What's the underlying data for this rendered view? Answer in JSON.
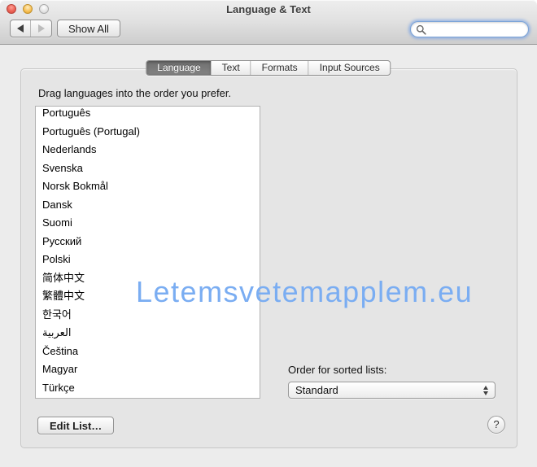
{
  "window": {
    "title": "Language & Text"
  },
  "toolbar": {
    "back_icon": "left-triangle",
    "forward_icon": "right-triangle",
    "show_all_label": "Show All",
    "search": {
      "value": "",
      "placeholder": "",
      "icon": "magnifier"
    }
  },
  "tabs": [
    {
      "label": "Language",
      "selected": true
    },
    {
      "label": "Text",
      "selected": false
    },
    {
      "label": "Formats",
      "selected": false
    },
    {
      "label": "Input Sources",
      "selected": false
    }
  ],
  "content": {
    "instruction": "Drag languages into the order you prefer.",
    "languages": [
      "Português",
      "Português (Portugal)",
      "Nederlands",
      "Svenska",
      "Norsk Bokmål",
      "Dansk",
      "Suomi",
      "Русский",
      "Polski",
      "简体中文",
      "繁體中文",
      "한국어",
      "العربية",
      "Čeština",
      "Magyar",
      "Türkçe"
    ],
    "sorted_lists_label": "Order for sorted lists:",
    "sorted_lists_value": "Standard",
    "edit_list_label": "Edit List…",
    "help_label": "?"
  },
  "watermark": {
    "text": "Letemsvetemapplem.eu",
    "color": "#7aadf2"
  },
  "colors": {
    "selected_tab": "#7a7a7a",
    "focus_ring": "#6296e6",
    "close_button": "#ec6255",
    "minimize_button": "#f6bd4e",
    "zoom_button_disabled": "#dcdcdc"
  }
}
